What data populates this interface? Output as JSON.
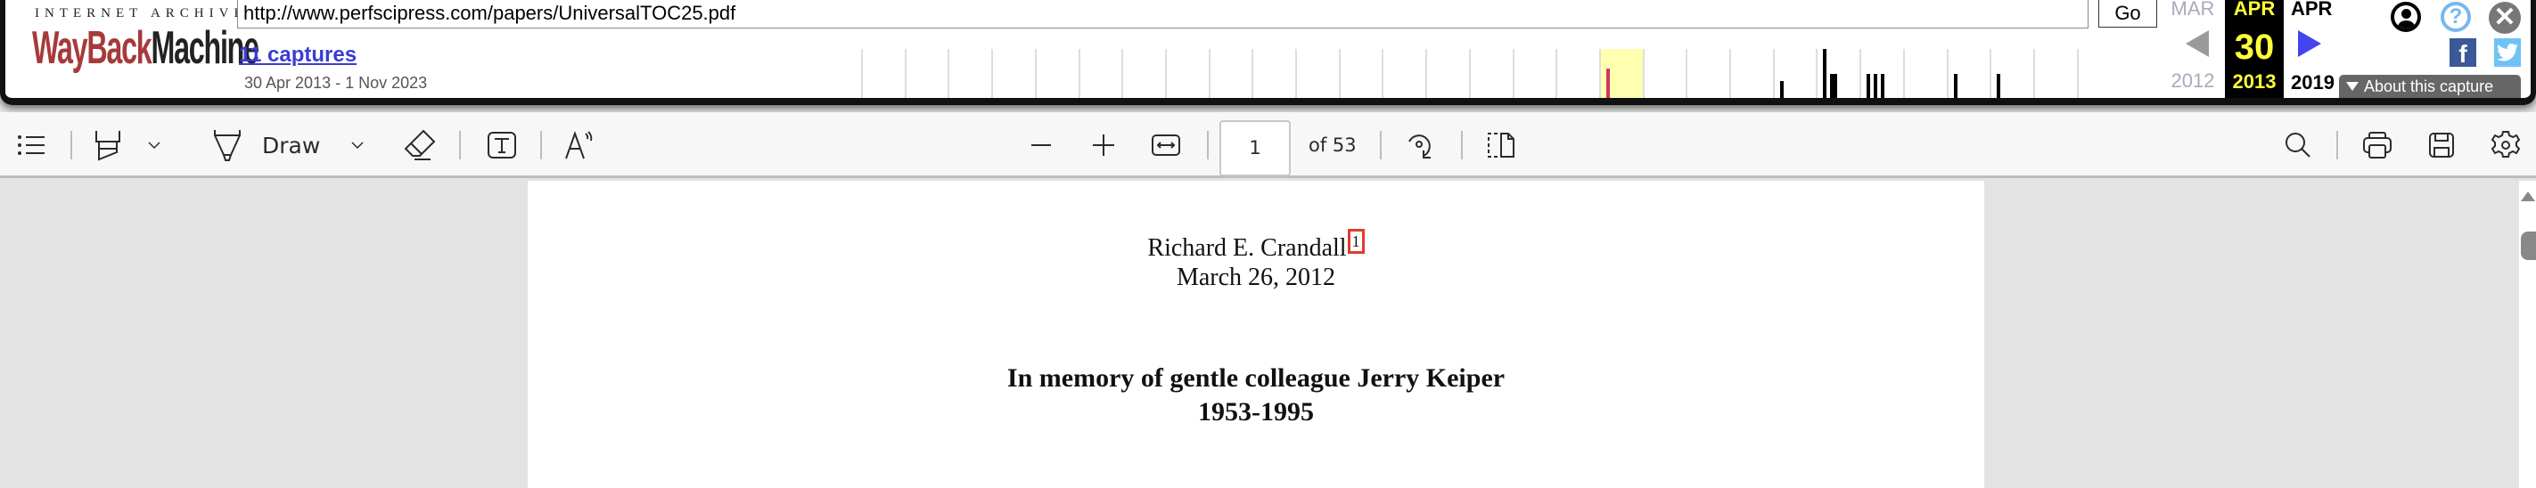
{
  "wayback": {
    "logo_top": "INTERNET ARCHIVE",
    "logo_wayback": "WayBack",
    "logo_machine": "Machine",
    "url_value": "http://www.perfscipress.com/papers/UniversalTOC25.pdf",
    "go_label": "Go",
    "captures_link": "11 captures",
    "capture_range": "30 Apr 2013 - 1 Nov 2023",
    "prev": {
      "month": "MAR",
      "year": "2012"
    },
    "current": {
      "month": "APR",
      "day": "30",
      "year": "2013"
    },
    "next": {
      "month": "APR",
      "year": "2019"
    },
    "about_label": "About this capture",
    "icons": [
      "user-icon",
      "help-icon",
      "close-icon",
      "facebook-icon",
      "twitter-icon"
    ],
    "colors": {
      "logo_red": "#a63a3a",
      "link": "#3b3bd6",
      "highlight": "#ffff3a",
      "current_capture": "#d0365f"
    },
    "sparkline": {
      "first_year": 1996,
      "last_year": 2024,
      "highlight_year": 2013,
      "captures": [
        {
          "year": 2013,
          "level": 0.6,
          "current": true
        },
        {
          "year": 2017,
          "level": 0.35
        },
        {
          "year": 2018,
          "level": 1.0
        },
        {
          "year": 2018,
          "level": 0.5,
          "wide": true
        },
        {
          "year": 2019,
          "level": 0.5
        },
        {
          "year": 2019,
          "level": 0.5
        },
        {
          "year": 2019,
          "level": 0.5
        },
        {
          "year": 2021,
          "level": 0.5
        },
        {
          "year": 2022,
          "level": 0.5
        }
      ]
    }
  },
  "pdf_toolbar": {
    "draw_label": "Draw",
    "page_current": "1",
    "page_of": "of 53",
    "icons": [
      "contents-icon",
      "highlight-icon",
      "chevron-down-icon",
      "draw-pen-icon",
      "chevron-down-icon",
      "eraser-icon",
      "text-box-icon",
      "read-aloud-icon",
      "zoom-out-icon",
      "zoom-in-icon",
      "fit-width-icon",
      "rotate-icon",
      "page-view-icon",
      "search-icon",
      "print-icon",
      "save-icon",
      "settings-icon"
    ]
  },
  "document": {
    "author": "Richard  E. Crandall",
    "footnote_mark": "1",
    "date": "March 26, 2012",
    "dedication": "In memory of gentle colleague Jerry Keiper",
    "years": "1953-1995"
  }
}
